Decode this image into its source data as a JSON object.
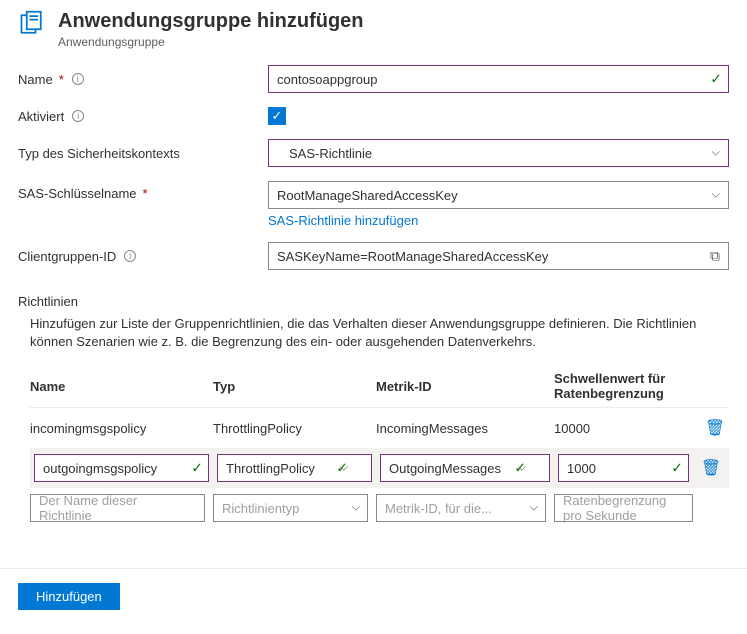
{
  "header": {
    "title": "Anwendungsgruppe hinzufügen",
    "subtitle": "Anwendungsgruppe"
  },
  "form": {
    "name_label": "Name",
    "name_value": "contosoappgroup",
    "activated_label": "Aktiviert",
    "activated_checked": true,
    "context_type_label": "Typ des Sicherheitskontexts",
    "context_type_value": "SAS-Richtlinie",
    "sas_key_label": "SAS-Schlüsselname",
    "sas_key_value": "RootManageSharedAccessKey",
    "sas_add_link": "SAS-Richtlinie hinzufügen",
    "client_group_label": "Clientgruppen-ID",
    "client_group_value": "SASKeyName=RootManageSharedAccessKey"
  },
  "policies": {
    "section_title": "Richtlinien",
    "section_desc": "Hinzufügen zur Liste der Gruppenrichtlinien, die das Verhalten dieser Anwendungsgruppe definieren. Die Richtlinien können Szenarien wie z. B. die Begrenzung des ein- oder ausgehenden Datenverkehrs.",
    "headers": {
      "name": "Name",
      "type": "Typ",
      "metric": "Metrik-ID",
      "threshold": "Schwellenwert für Ratenbegrenzung"
    },
    "rows": [
      {
        "name": "incomingmsgspolicy",
        "type": "ThrottlingPolicy",
        "metric": "IncomingMessages",
        "threshold": "10000",
        "mode": "static"
      },
      {
        "name": "outgoingmsgspolicy",
        "type": "ThrottlingPolicy",
        "metric": "OutgoingMessages",
        "threshold": "1000",
        "mode": "editing"
      }
    ],
    "placeholders": {
      "name": "Der Name dieser Richtlinie",
      "type": "Richtlinientyp",
      "metric": "Metrik-ID, für die...",
      "threshold": "Ratenbegrenzung pro Sekunde"
    }
  },
  "footer": {
    "add_button": "Hinzufügen"
  }
}
